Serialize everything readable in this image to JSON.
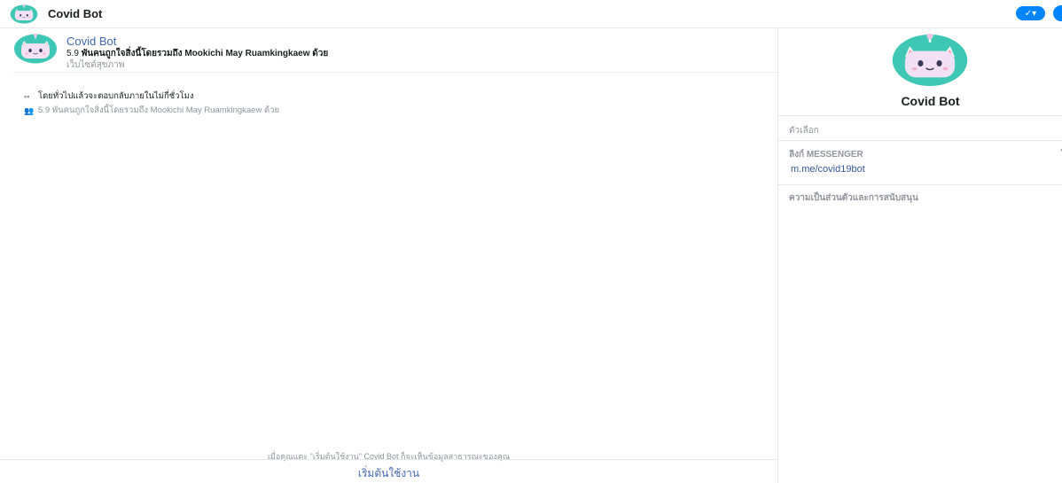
{
  "header": {
    "title": "Covid Bot",
    "check_icon": "check-icon"
  },
  "chat": {
    "bot_name": "Covid Bot",
    "likes_count": "5.9",
    "likes_text": "พันคนถูกใจสิ่งนี้โดยรวมถึง Mookichi May Ruamkingkaew ด้วย",
    "category": "เว็บไซต์สุขภาพ",
    "response_time": "โดยทั่วไปแล้วจะตอบกลับภายในไม่กี่ชั่วโมง",
    "likes_detail": "5.9 พันคนถูกใจสิ่งนี้โดยรวมถึง Mookichi May Ruamkingkaew ด้วย",
    "disclaimer": "เมื่อคุณแตะ \"เริ่มต้นใช้งาน\" Covid Bot ก็จะเห็นข้อมูลสาธารณะของคุณ",
    "start_label": "เริ่มต้นใช้งาน"
  },
  "side": {
    "bot_name": "Covid Bot",
    "options_label": "ตัวเลือก",
    "messenger_link_label": "ลิงก์ MESSENGER",
    "messenger_link": "m.me/covid19bot",
    "privacy_label": "ความเป็นส่วนตัวและการสนับสนุน"
  },
  "colors": {
    "accent": "#0084ff",
    "link": "#4267b2",
    "avatar_bg": "#3ec7b4",
    "avatar_face": "#f2c4e6"
  }
}
